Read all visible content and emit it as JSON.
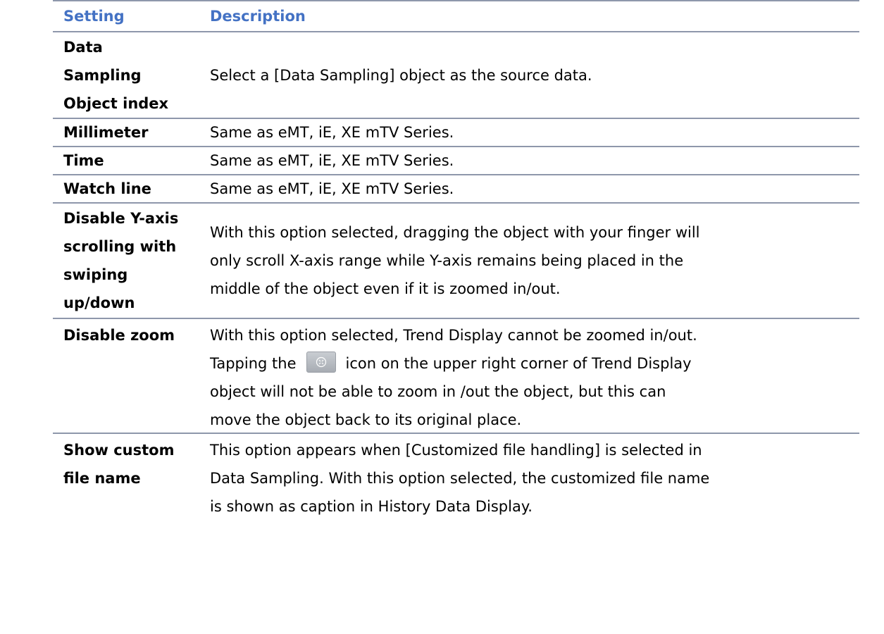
{
  "table": {
    "header": {
      "setting": "Setting",
      "description": "Description"
    },
    "rows": [
      {
        "setting": "Data\nSampling\nObject index",
        "description": "Select a [Data Sampling] object as the source data."
      },
      {
        "setting": "Millimeter",
        "description": "Same as eMT, iE, XE mTV Series."
      },
      {
        "setting": "Time",
        "description": "Same as eMT, iE, XE mTV Series."
      },
      {
        "setting": "Watch line",
        "description": "Same as eMT, iE, XE mTV Series."
      },
      {
        "setting": "Disable Y-axis\nscrolling with\nswiping\nup/down",
        "description": "With this option selected, dragging the object with your finger will\nonly scroll X-axis range while Y-axis remains being placed in the\nmiddle of the object even if it is zoomed in/out."
      },
      {
        "setting": "Disable zoom",
        "description_line1": "With this option selected, Trend Display cannot be zoomed in/out.",
        "description_line2_before": "Tapping the",
        "description_line2_after": "icon on the upper right corner of Trend Display",
        "description_rest": "object will not be able to zoom in /out the object, but this can\nmove the object back to its original place.",
        "icon": "zoom-reset-icon"
      },
      {
        "setting": "Show custom\nfile name",
        "description": "This option appears when [Customized file handling] is selected in\nData Sampling. With this option selected, the customized file name\nis shown as caption in History Data Display."
      }
    ]
  },
  "colors": {
    "header_text": "#4472c4",
    "rule": "#8e97ab"
  }
}
